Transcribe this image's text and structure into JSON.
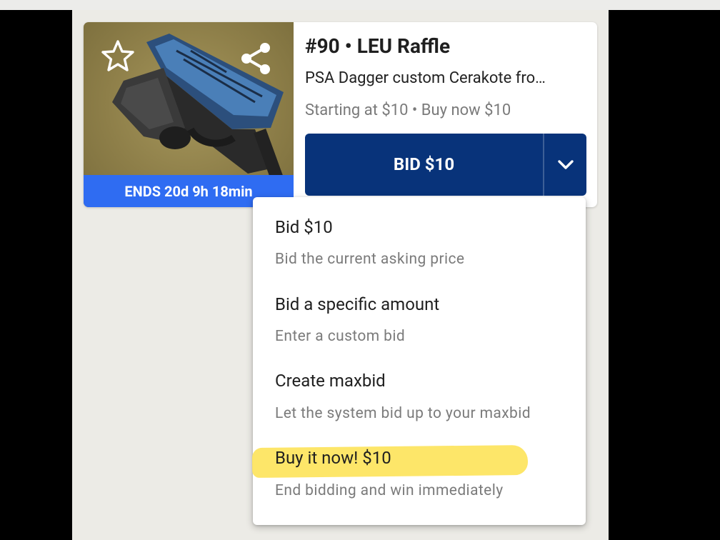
{
  "listing": {
    "title": "#90 • LEU Raffle",
    "description": "PSA Dagger custom Cerakote fro…",
    "price_line": "Starting at $10 • Buy now $10",
    "ends_label": "ENDS 20d 9h 18min"
  },
  "actions": {
    "bid_label": "BID $10"
  },
  "menu": {
    "items": [
      {
        "title": "Bid $10",
        "subtitle": "Bid the current asking price"
      },
      {
        "title": "Bid a specific amount",
        "subtitle": "Enter a custom bid"
      },
      {
        "title": "Create maxbid",
        "subtitle": "Let the system bid up to your maxbid"
      },
      {
        "title": "Buy it now! $10",
        "subtitle": "End bidding and win immediately"
      }
    ]
  },
  "icons": {
    "favorite": "star-outline-icon",
    "share": "share-icon",
    "expand": "chevron-down-icon"
  },
  "colors": {
    "primary": "#08337a",
    "ends_bar": "#2f6cf2",
    "highlight": "#fde45c"
  }
}
